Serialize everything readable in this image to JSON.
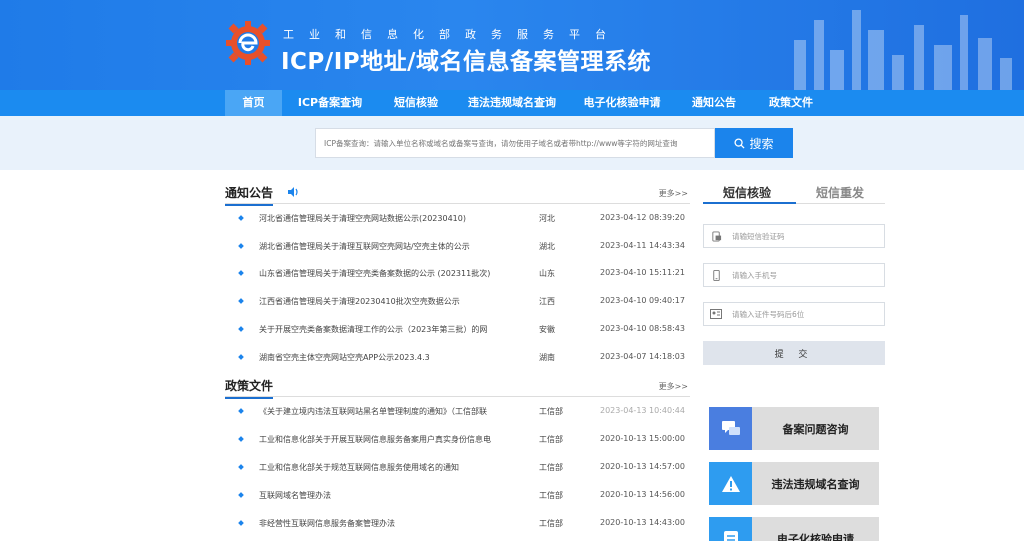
{
  "header": {
    "subtitle": "工业和信息化部政务服务平台",
    "title": "ICP/IP地址/域名信息备案管理系统"
  },
  "nav": {
    "items": [
      {
        "label": "首页",
        "active": true
      },
      {
        "label": "ICP备案查询"
      },
      {
        "label": "短信核验"
      },
      {
        "label": "违法违规域名查询"
      },
      {
        "label": "电子化核验申请"
      },
      {
        "label": "通知公告"
      },
      {
        "label": "政策文件"
      }
    ]
  },
  "search": {
    "placeholder": "ICP备案查询：请输入单位名称或域名或备案号查询，请勿使用子域名或者带http://www等字符的网址查询",
    "button_label": "搜索"
  },
  "notices": {
    "title": "通知公告",
    "more": "更多>>",
    "items": [
      {
        "title": "河北省通信管理局关于清理空壳网站数据公示(20230410)",
        "region": "河北",
        "date": "2023-04-12 08:39:20"
      },
      {
        "title": "湖北省通信管理局关于清理互联网空壳网站/空壳主体的公示",
        "region": "湖北",
        "date": "2023-04-11 14:43:34"
      },
      {
        "title": "山东省通信管理局关于清理空壳类备案数据的公示 (202311批次)",
        "region": "山东",
        "date": "2023-04-10 15:11:21"
      },
      {
        "title": "江西省通信管理局关于清理20230410批次空壳数据公示",
        "region": "江西",
        "date": "2023-04-10 09:40:17"
      },
      {
        "title": "关于开展空壳类备案数据清理工作的公示（2023年第三批）的网",
        "region": "安徽",
        "date": "2023-04-10 08:58:43"
      },
      {
        "title": "湖南省空壳主体空壳网站空壳APP公示2023.4.3",
        "region": "湖南",
        "date": "2023-04-07 14:18:03"
      }
    ]
  },
  "policies": {
    "title": "政策文件",
    "more": "更多>>",
    "items": [
      {
        "title": "《关于建立境内违法互联网站黑名单管理制度的通知》（工信部联",
        "region": "工信部",
        "date": "2023-04-13 10:40:44",
        "muted": true
      },
      {
        "title": "工业和信息化部关于开展互联网信息服务备案用户真实身份信息电",
        "region": "工信部",
        "date": "2020-10-13 15:00:00"
      },
      {
        "title": "工业和信息化部关于规范互联网信息服务使用域名的通知",
        "region": "工信部",
        "date": "2020-10-13 14:57:00"
      },
      {
        "title": "互联网域名管理办法",
        "region": "工信部",
        "date": "2020-10-13 14:56:00"
      },
      {
        "title": "非经营性互联网信息服务备案管理办法",
        "region": "工信部",
        "date": "2020-10-13 14:43:00"
      }
    ]
  },
  "sms": {
    "tab_verify": "短信核验",
    "tab_resend": "短信重发",
    "code_placeholder": "请输短信验证码",
    "phone_placeholder": "请输入手机号",
    "id_placeholder": "请输入证件号码后6位",
    "submit_label": "提 交"
  },
  "quick_links": [
    {
      "label": "备案问题咨询",
      "icon": "chat-icon"
    },
    {
      "label": "违法违规域名查询",
      "icon": "warning-icon"
    },
    {
      "label": "电子化核验申请",
      "icon": "document-icon"
    }
  ],
  "colors": {
    "brand_blue": "#1b84ec",
    "nav_blue": "#1b8bf0",
    "search_band": "#e9f2fb"
  }
}
